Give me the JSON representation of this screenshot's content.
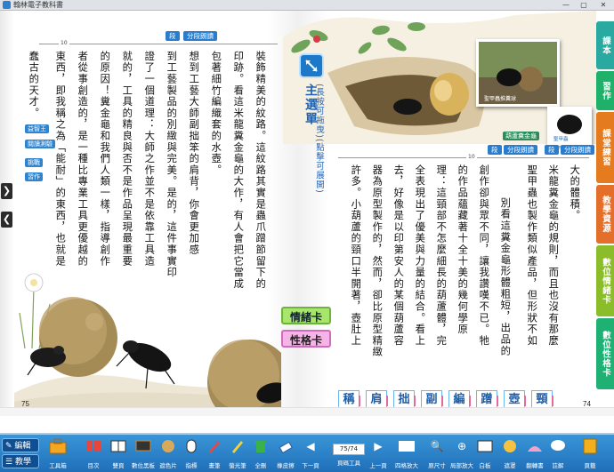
{
  "window": {
    "title": "翰林電子教科書",
    "min": "—",
    "max": "▢",
    "close": "✕"
  },
  "pages": {
    "left_number": "75",
    "right_number": "74"
  },
  "left_page": {
    "section_buttons": [
      "段",
      "分段朗讀"
    ],
    "ruler_tick": "10",
    "columns": [
      "蠢古的天才。",
      "東西，即我稱之為「能耐」的東西，也就是",
      "者從事創造的，是一種比專業工具更優越的",
      "的原因！糞金龜和我們人類一樣，指導創作",
      "就的，工具的精良與否不是作品呈現最重要",
      "證了一個道理：大師之作並不是依靠工具造",
      "到工藝製品的別緻與完美。是的，這件事實印",
      "想到工藝大師副拙笨的肩背，你會更加感",
      "包著細竹編織套的水壺。",
      "印跡。看這米龍糞金龜的大作，有人會把它當成",
      "裝飾精美的紋路。這紋路其實是蟲爪蹭節留下的"
    ],
    "side_badges": [
      "益智王",
      "閱讀測驗",
      "挑戰",
      "習作"
    ]
  },
  "right_page": {
    "section_buttons": [
      "段",
      "分段朗讀"
    ],
    "ruler_tick": "10",
    "columns": [
      "大的體積。",
      "米龍糞金龜的規則，而且也沒有那麼",
      "聖甲蟲也製作類似產品，但形狀不如",
      "別看這糞金龜形體粗短，出品的",
      "創作卻與眾不同，讓我讚嘆不已。牠",
      "的作品蘊藏著十全十美的幾何學原",
      "理：這頸部不怎麼細長的葫蘆體，完",
      "全表現出了優美與力量的結合。看上",
      "去，好像是以印第安人的某個葫蘆容",
      "器為原型製作的，然而，卻比原型精緻",
      "許多。小葫蘆的頸口半開著，壺肚上"
    ]
  },
  "main_topic": {
    "title": "主選單",
    "hint": "(長按可拖曳)(點擊可展開)"
  },
  "cards": {
    "mood": "情緒卡",
    "character": "性格卡"
  },
  "photo_captions": {
    "top": "聖甲蟲推糞球",
    "mid": "葫蘆糞金龜",
    "right": "聖甲蟲"
  },
  "word_strip": [
    "稱",
    "肩",
    "拙",
    "副",
    "編",
    "蹭",
    "壺",
    "頸"
  ],
  "tabs": [
    {
      "label": "課本",
      "color": "#2aa9a0"
    },
    {
      "label": "習作",
      "color": "#1fb06a"
    },
    {
      "label": "課堂練習",
      "color": "#e57b1f"
    },
    {
      "label": "教學資源",
      "color": "#e46f2a"
    },
    {
      "label": "數位情緒卡",
      "color": "#8bbd2b"
    },
    {
      "label": "數位性格卡",
      "color": "#1fb073"
    }
  ],
  "toolbar": {
    "mode_edit": "編輯",
    "mode_teach": "教學",
    "toolbox": "工具箱",
    "tools": [
      "目次",
      "雙頁",
      "數位黑板",
      "遮色片",
      "指標",
      "畫筆",
      "螢光筆",
      "全刪",
      "橡皮擦",
      "下一頁",
      "頁碼工具",
      "上一頁",
      "四格放大",
      "原尺寸",
      "局部放大",
      "白板",
      "遮罩",
      "翻轉書",
      "註解",
      "頁籤"
    ],
    "page_value": "75/74"
  }
}
